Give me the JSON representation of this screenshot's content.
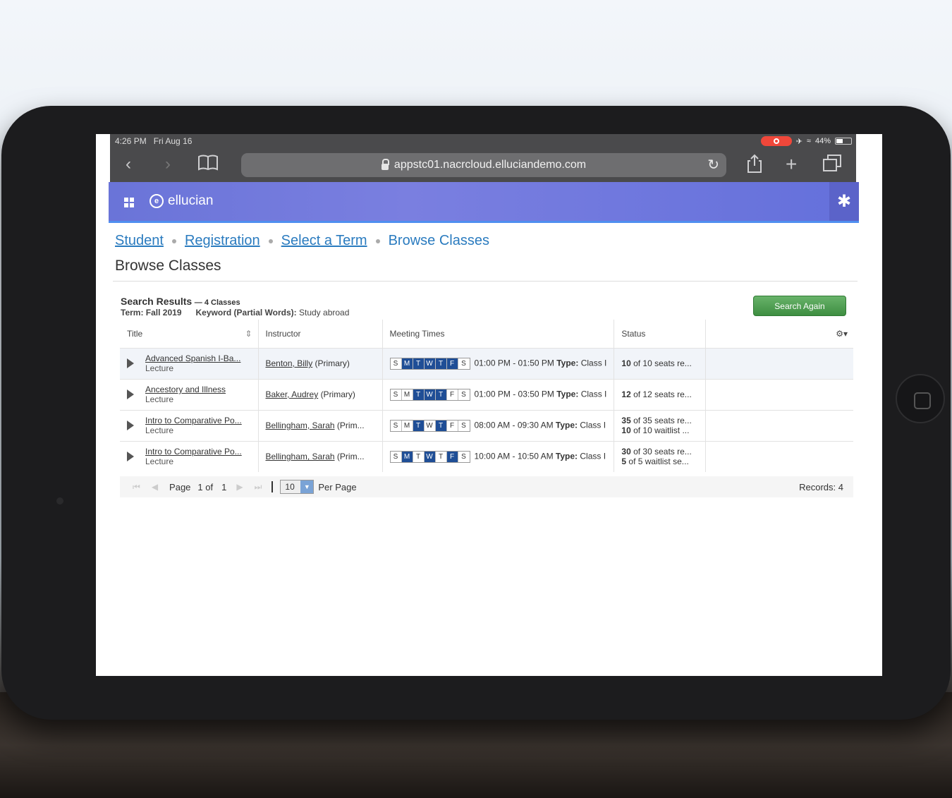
{
  "status_bar": {
    "time": "4:26 PM",
    "date": "Fri Aug 16",
    "battery": "44%"
  },
  "browser": {
    "url": "appstc01.nacrcloud.elluciandemo.com"
  },
  "app": {
    "brand": "ellucian"
  },
  "breadcrumb": [
    "Student",
    "Registration",
    "Select a Term",
    "Browse Classes"
  ],
  "page_title": "Browse Classes",
  "search": {
    "heading": "Search Results",
    "count": "— 4 Classes",
    "term_label": "Term:",
    "term_value": "Fall 2019",
    "keyword_label": "Keyword (Partial Words):",
    "keyword_value": "Study abroad",
    "button": "Search Again"
  },
  "columns": {
    "title": "Title",
    "instructor": "Instructor",
    "meeting_times": "Meeting Times",
    "status": "Status"
  },
  "rows": [
    {
      "title": "Advanced Spanish I-Ba...",
      "type": "Lecture",
      "instructor": "Benton, Billy",
      "role": "(Primary)",
      "days": [
        "S",
        "M",
        "T",
        "W",
        "T",
        "F",
        "S"
      ],
      "active": [
        false,
        true,
        true,
        true,
        true,
        true,
        false
      ],
      "time": "01:00 PM - 01:50 PM",
      "type_label": "Type:",
      "type_value": "Class I",
      "status1_bold": "10",
      "status1": " of 10 seats re...",
      "status2_bold": "",
      "status2": ""
    },
    {
      "title": "Ancestory and Illness",
      "type": "Lecture",
      "instructor": "Baker, Audrey",
      "role": "(Primary)",
      "days": [
        "S",
        "M",
        "T",
        "W",
        "T",
        "F",
        "S"
      ],
      "active": [
        false,
        false,
        true,
        true,
        true,
        false,
        false
      ],
      "time": "01:00 PM - 03:50 PM",
      "type_label": "Type:",
      "type_value": "Class I",
      "status1_bold": "12",
      "status1": " of 12 seats re...",
      "status2_bold": "",
      "status2": ""
    },
    {
      "title": "Intro to Comparative Po...",
      "type": "Lecture",
      "instructor": "Bellingham, Sarah",
      "role": "(Prim...",
      "days": [
        "S",
        "M",
        "T",
        "W",
        "T",
        "F",
        "S"
      ],
      "active": [
        false,
        false,
        true,
        false,
        true,
        false,
        false
      ],
      "time": "08:00 AM - 09:30 AM",
      "type_label": "Type:",
      "type_value": "Class I",
      "status1_bold": "35",
      "status1": " of 35 seats re...",
      "status2_bold": "10",
      "status2": " of 10 waitlist ..."
    },
    {
      "title": "Intro to Comparative Po...",
      "type": "Lecture",
      "instructor": "Bellingham, Sarah",
      "role": "(Prim...",
      "days": [
        "S",
        "M",
        "T",
        "W",
        "T",
        "F",
        "S"
      ],
      "active": [
        false,
        true,
        false,
        true,
        false,
        true,
        false
      ],
      "time": "10:00 AM - 10:50 AM",
      "type_label": "Type:",
      "type_value": "Class I",
      "status1_bold": "30",
      "status1": " of 30 seats re...",
      "status2_bold": "5",
      "status2": " of 5 waitlist se..."
    }
  ],
  "pager": {
    "page_label": "Page",
    "page_value": "1 of",
    "total_pages": "1",
    "per_page_value": "10",
    "per_page_label": "Per Page",
    "records": "Records: 4"
  },
  "icons": [
    "back-chevron-icon",
    "forward-chevron-icon",
    "bookmarks-icon",
    "lock-icon",
    "reload-icon",
    "share-icon",
    "new-tab-icon",
    "tabs-icon",
    "app-grid-icon",
    "ellucian-logo-icon",
    "settings-gear-icon",
    "expand-triangle-icon"
  ]
}
